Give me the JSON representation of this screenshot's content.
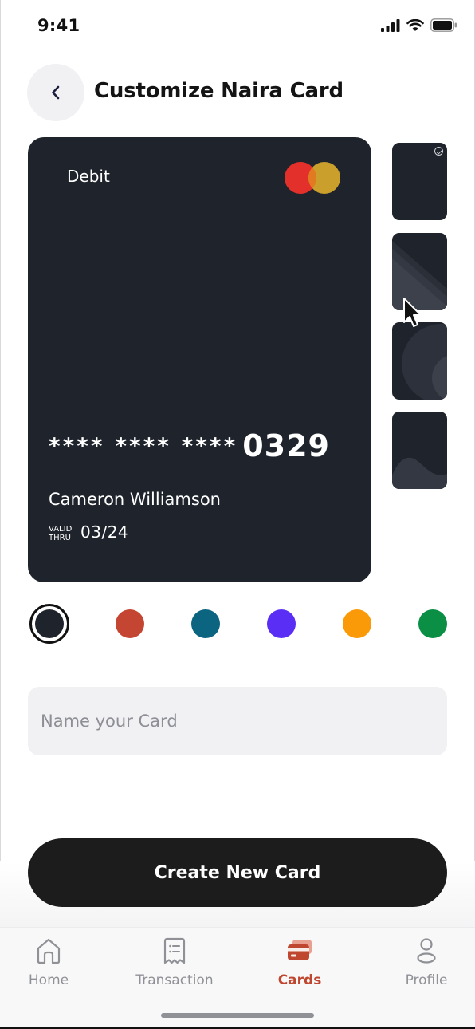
{
  "status_bar": {
    "time": "9:41"
  },
  "header": {
    "title": "Customize Naira Card"
  },
  "card": {
    "type_label": "Debit",
    "masked_digits": "**** **** ****",
    "last_four": "0329",
    "holder_name": "Cameron Williamson",
    "valid_label": "VALID THRU",
    "expiry": "03/24",
    "background_color": "#1f232c",
    "network_icon": "mastercard-logo"
  },
  "designs": [
    {
      "name": "plain",
      "selected": true
    },
    {
      "name": "diagonal-stripes",
      "selected": false
    },
    {
      "name": "circles",
      "selected": false
    },
    {
      "name": "waves",
      "selected": false
    }
  ],
  "colors": [
    {
      "name": "dark-navy",
      "hex": "#1f232c",
      "selected": true
    },
    {
      "name": "rust",
      "hex": "#c44632"
    },
    {
      "name": "teal",
      "hex": "#0b6580"
    },
    {
      "name": "violet",
      "hex": "#5a2ef5"
    },
    {
      "name": "orange",
      "hex": "#fa9a08"
    },
    {
      "name": "green",
      "hex": "#0a8f45"
    }
  ],
  "name_input": {
    "placeholder": "Name your Card",
    "value": ""
  },
  "create_button": {
    "label": "Create New Card"
  },
  "tabbar": {
    "items": [
      {
        "label": "Home",
        "icon": "home-icon",
        "active": false
      },
      {
        "label": "Transaction",
        "icon": "receipt-icon",
        "active": false
      },
      {
        "label": "Cards",
        "icon": "card-icon",
        "active": true
      },
      {
        "label": "Profile",
        "icon": "profile-icon",
        "active": false
      }
    ],
    "active_color": "#c0472f"
  }
}
